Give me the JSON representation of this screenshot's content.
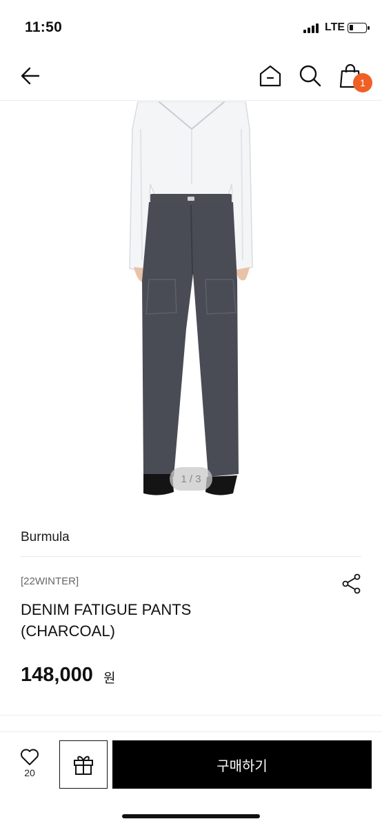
{
  "status_bar": {
    "time": "11:50",
    "network": "LTE"
  },
  "header": {
    "back_icon": "arrow-left-icon",
    "home_icon": "home-icon",
    "search_icon": "search-icon",
    "cart_icon": "shopping-bag-icon",
    "cart_count": "1",
    "badge_color": "#ef6024"
  },
  "gallery": {
    "page_indicator": "1 / 3"
  },
  "product": {
    "brand": "Burmula",
    "season": "[22WINTER]",
    "title_line1": "DENIM FATIGUE PANTS",
    "title_line2": "(CHARCOAL)",
    "price": "148,000",
    "currency": "원"
  },
  "bottom_bar": {
    "like_icon": "heart-icon",
    "like_count": "20",
    "gift_icon": "gift-icon",
    "buy_label": "구매하기"
  }
}
